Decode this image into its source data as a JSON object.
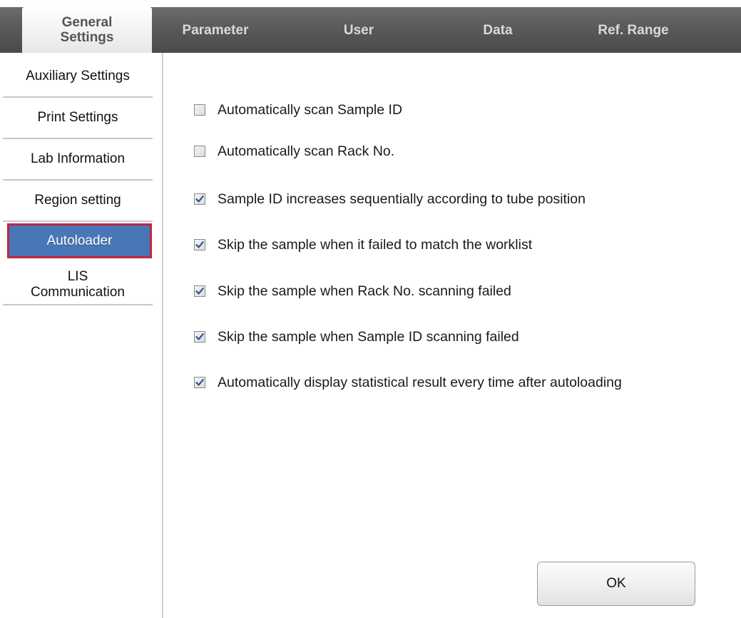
{
  "tabs": [
    {
      "label": "General\nSettings",
      "active": true
    },
    {
      "label": "Parameter",
      "active": false
    },
    {
      "label": "User",
      "active": false
    },
    {
      "label": "Data",
      "active": false
    },
    {
      "label": "Ref. Range",
      "active": false
    }
  ],
  "sidebar": {
    "items": [
      {
        "label": "Auxiliary Settings",
        "active": false
      },
      {
        "label": "Print Settings",
        "active": false
      },
      {
        "label": "Lab Information",
        "active": false
      },
      {
        "label": "Region setting",
        "active": false
      },
      {
        "label": "Autoloader",
        "active": true
      },
      {
        "label": "LIS\nCommunication",
        "active": false
      }
    ]
  },
  "options": [
    {
      "label": "Automatically scan Sample ID",
      "checked": false
    },
    {
      "label": "Automatically scan Rack No.",
      "checked": false
    },
    {
      "label": "Sample ID increases sequentially according to tube position",
      "checked": true
    },
    {
      "label": "Skip the sample when it failed to match the worklist",
      "checked": true
    },
    {
      "label": "Skip the sample when Rack No. scanning failed",
      "checked": true
    },
    {
      "label": "Skip the sample when Sample ID scanning failed",
      "checked": true
    },
    {
      "label": "Automatically display statistical result every time after autoloading",
      "checked": true
    }
  ],
  "ok_button": {
    "label": "OK"
  },
  "colors": {
    "tab_bar": "#5a5a5a",
    "active_side_item": "#4876b6",
    "highlight_border": "#c0283a",
    "check_mark": "#2f4fa0"
  }
}
